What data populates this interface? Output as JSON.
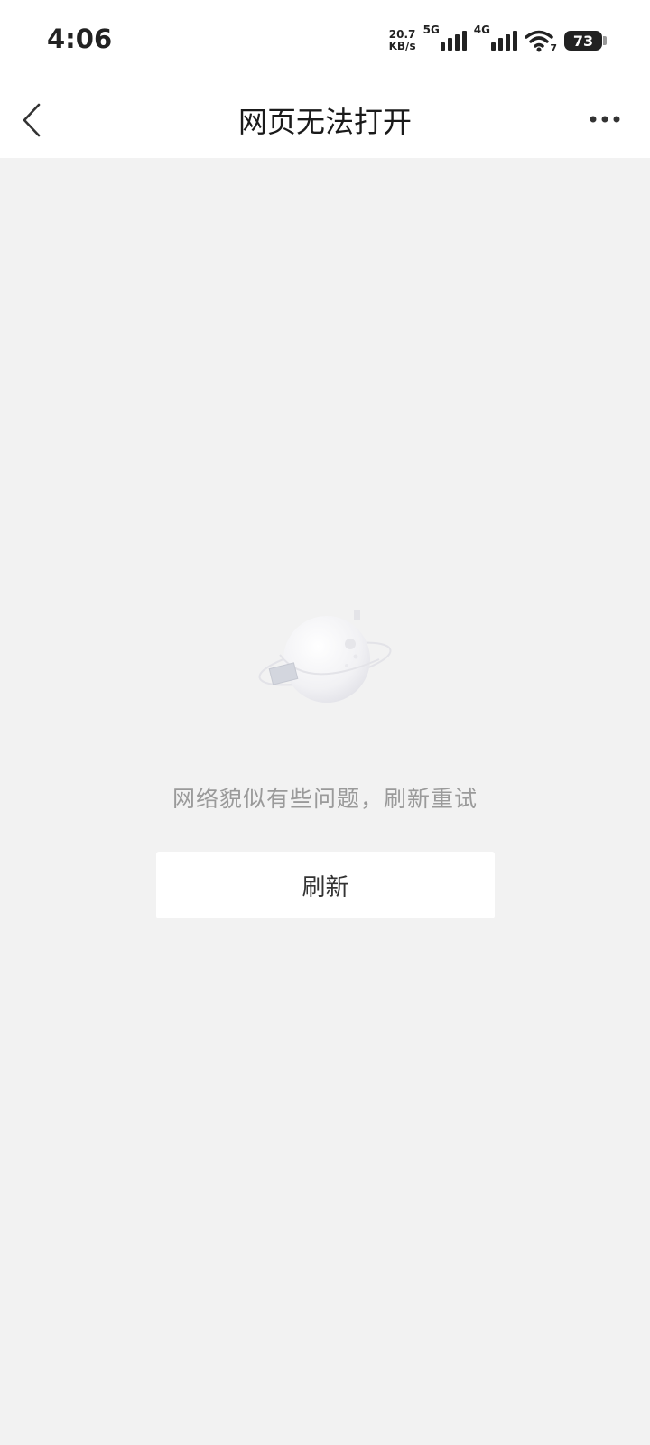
{
  "status_bar": {
    "time": "4:06",
    "net_speed_value": "20.7",
    "net_speed_unit": "KB/s",
    "signal_1_label": "5G",
    "signal_2_label": "4G",
    "wifi_badge": "7",
    "battery_level": "73"
  },
  "nav": {
    "title": "网页无法打开",
    "back_icon": "chevron-left-icon",
    "more_icon": "more-horizontal-icon"
  },
  "error": {
    "message": "网络貌似有些问题，刷新重试",
    "refresh_label": "刷新",
    "illustration": "planet-offline-illustration"
  },
  "colors": {
    "background": "#f2f2f2",
    "bar_background": "#ffffff",
    "message_text": "#9a9a9a",
    "title_text": "#1a1a1a"
  }
}
